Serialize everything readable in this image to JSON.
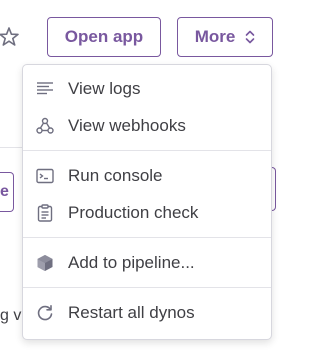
{
  "header": {
    "open_app_label": "Open app",
    "more_label": "More"
  },
  "background": {
    "input_fragment": "e",
    "text_fragment": "g va"
  },
  "menu": {
    "view_logs": "View logs",
    "view_webhooks": "View webhooks",
    "run_console": "Run console",
    "production_check": "Production check",
    "add_to_pipeline": "Add to pipeline...",
    "restart_all_dynos": "Restart all dynos"
  },
  "colors": {
    "accent": "#79589f",
    "text": "#3f3f44",
    "icon": "#6f6f80",
    "border": "#d7d7de"
  },
  "icons": [
    "star-icon",
    "chevron-updown-icon",
    "logs-icon",
    "webhooks-icon",
    "console-icon",
    "clipboard-icon",
    "pipeline-icon",
    "restart-icon"
  ]
}
